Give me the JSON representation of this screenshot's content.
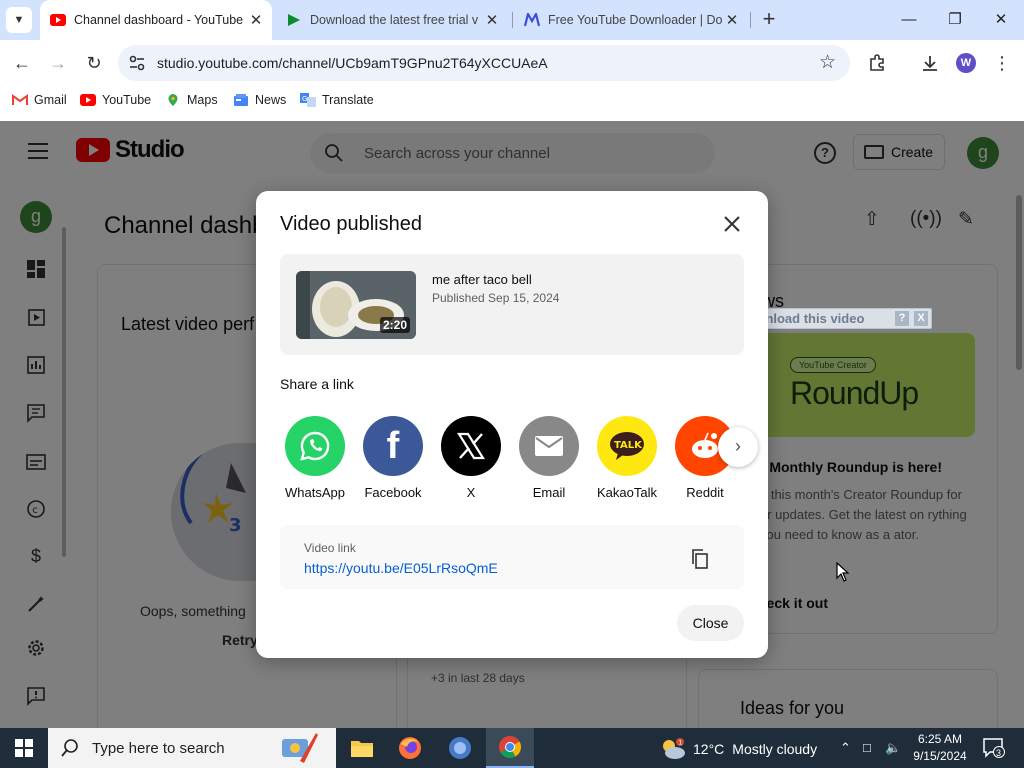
{
  "browser": {
    "tabs": [
      {
        "title": "Channel dashboard - YouTube",
        "active": true
      },
      {
        "title": "Download the latest free trial v",
        "active": false
      },
      {
        "title": "Free YouTube Downloader | Do",
        "active": false
      }
    ],
    "url": "studio.youtube.com/channel/UCb9amT9GPnu2T64yXCCUAeA",
    "profile_initial": "W",
    "bookmarks": [
      "Gmail",
      "YouTube",
      "Maps",
      "News",
      "Translate"
    ]
  },
  "studio": {
    "logo_text": "Studio",
    "search_placeholder": "Search across your channel",
    "create_label": "Create",
    "avatar_initial": "g",
    "page_title": "Channel dashb",
    "latest_card_title": "Latest video perf",
    "oops_text": "Oops, something",
    "retry_label": "Retry",
    "news_card_title": "ws",
    "roundup_pill": "YouTube Creator",
    "roundup_word": "RoundUp",
    "news_headline": "r Monthly Roundup is here!",
    "news_body": "h this month's Creator Roundup for ur updates. Get the latest on rything you need to know as a ator.",
    "check_out_label": "heck it out",
    "stat_text": "+3 in last 28 days",
    "ideas_title": "Ideas for you"
  },
  "download_overlay": {
    "label": "Download this video",
    "help": "?",
    "close": "X"
  },
  "modal": {
    "title": "Video published",
    "video_title": "me after taco bell",
    "video_date": "Published Sep 15, 2024",
    "duration": "2:20",
    "share_label": "Share a link",
    "share_targets": [
      {
        "label": "WhatsApp",
        "color": "#25d366"
      },
      {
        "label": "Facebook",
        "color": "#3b5998"
      },
      {
        "label": "X",
        "color": "#000000"
      },
      {
        "label": "Email",
        "color": "#888888"
      },
      {
        "label": "KakaoTalk",
        "color": "#ffe812"
      },
      {
        "label": "Reddit",
        "color": "#ff4500"
      }
    ],
    "link_label": "Video link",
    "link_url": "https://youtu.be/E05LrRsoQmE",
    "close_label": "Close"
  },
  "taskbar": {
    "search_placeholder": "Type here to search",
    "weather_temp": "12°C",
    "weather_text": "Mostly cloudy",
    "time": "6:25 AM",
    "date": "9/15/2024",
    "notifications": "3"
  },
  "colors": {
    "youtube_red": "#ff0000",
    "link_blue": "#065fd4",
    "avatar_green": "#3d8b36"
  }
}
